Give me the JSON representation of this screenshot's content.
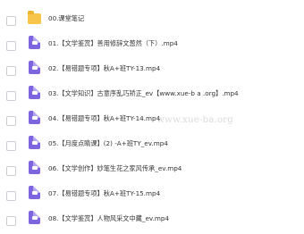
{
  "files": [
    {
      "type": "folder",
      "icon": "folder-icon",
      "name": "00.课堂笔记"
    },
    {
      "type": "video",
      "icon": "video-file-icon",
      "name": "01.【文学鉴赏】善用修辞文葱然（下）.mp4"
    },
    {
      "type": "video",
      "icon": "video-file-icon",
      "name": "02.【易错题专项】秋A+班TY-13.mp4"
    },
    {
      "type": "video",
      "icon": "video-file-icon",
      "name": "03.【文学知识】古意序乱巧矫正_ev【www.xue-b a .org】.mp4"
    },
    {
      "type": "video",
      "icon": "video-file-icon",
      "name": "04.【易错题专项】秋A+班TY-14.mp4"
    },
    {
      "type": "video",
      "icon": "video-file-icon",
      "name": "05.【月度点睛课】(2) -A+班TY_ev.mp4"
    },
    {
      "type": "video",
      "icon": "video-file-icon",
      "name": "06.【文学创作】妙笔生花之家风传承_ev.mp4"
    },
    {
      "type": "video",
      "icon": "video-file-icon",
      "name": "07.【易错题专项】秋A+班TY-15.mp4"
    },
    {
      "type": "video",
      "icon": "video-file-icon",
      "name": "08.【文学鉴赏】人物风采文中藏_ev.mp4"
    }
  ],
  "watermark": "www.xue-ba.org"
}
